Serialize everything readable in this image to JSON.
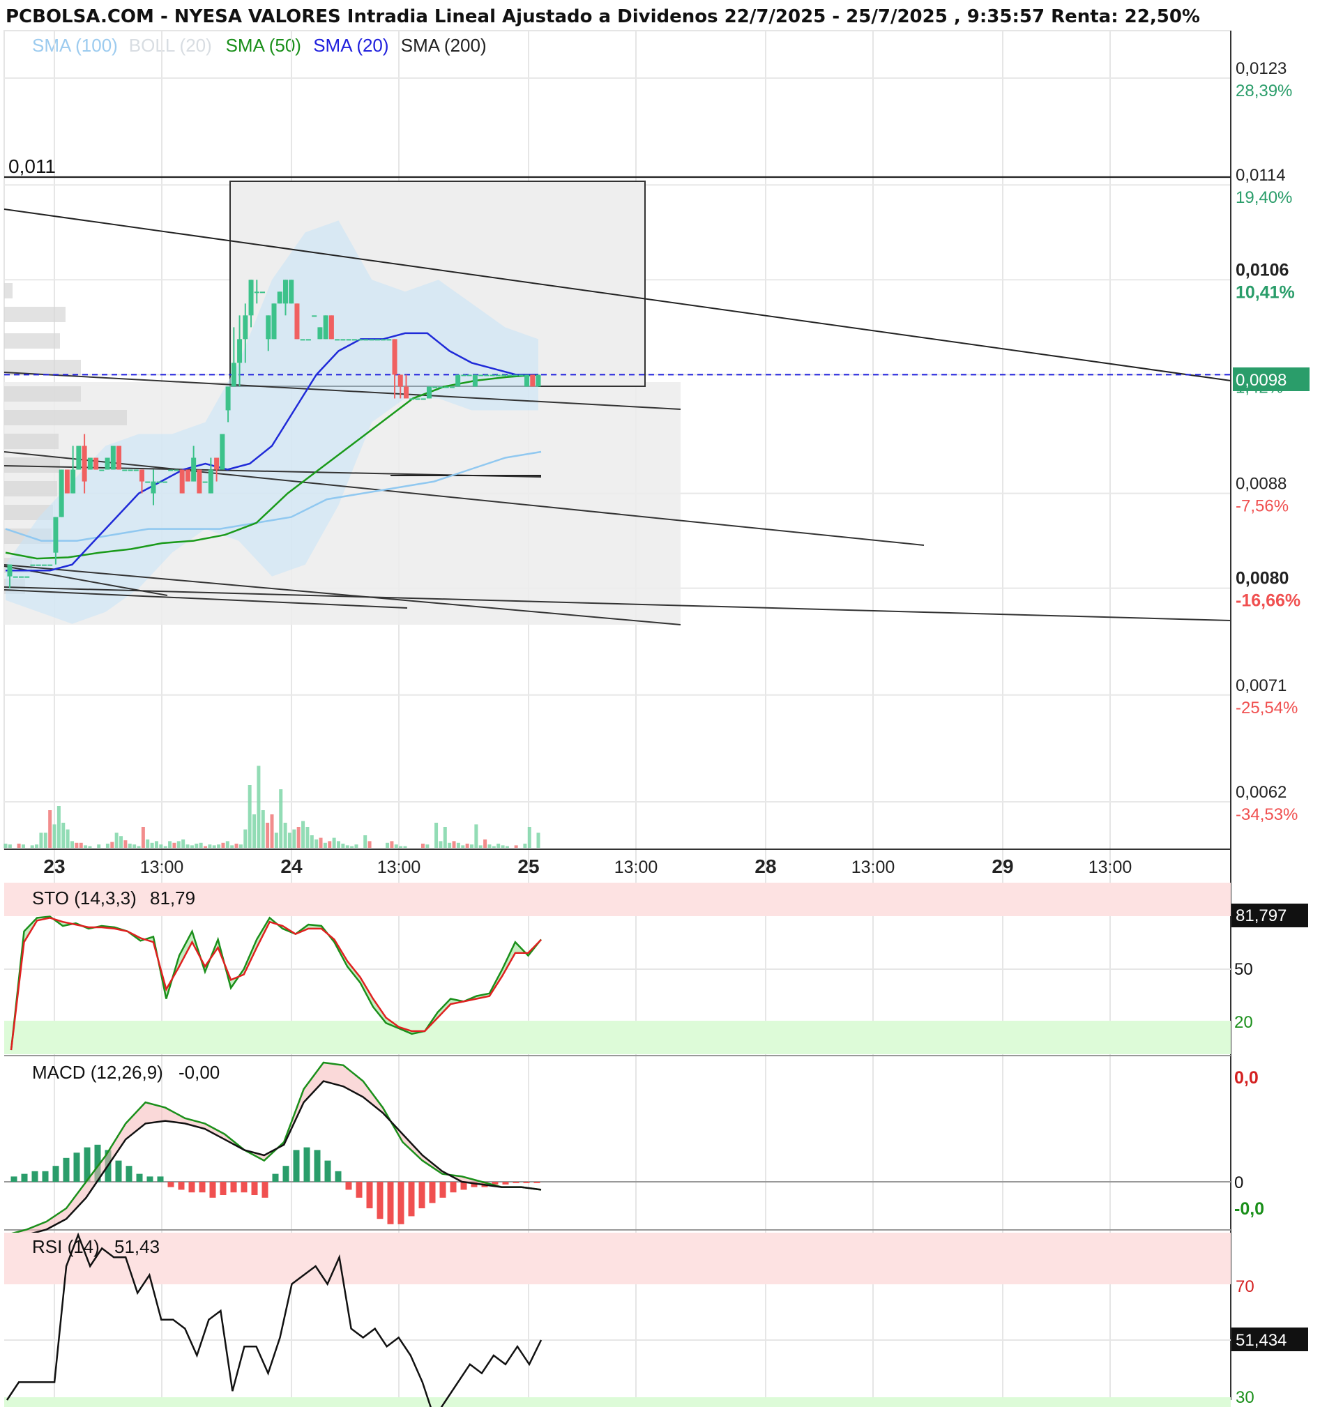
{
  "title": "PCBOLSA.COM - NYESA VALORES Intradia Lineal Ajustado a Dividenos 22/7/2025 - 25/7/2025 , 9:35:57 Renta: 22,50%",
  "colors": {
    "sma100": "#90c8f0",
    "boll": "#cfd6dc",
    "sma50": "#1a9a1a",
    "sma20": "#1f2ad8",
    "sma200": "#222222",
    "up": "#3cc28a",
    "down": "#f06060",
    "current_tag": "#2a9d6a",
    "overbought_fill": "#fde2e2",
    "oversold_fill": "#ddfbd8"
  },
  "legend": [
    {
      "label": "SMA (100)",
      "color": "#9ccbef"
    },
    {
      "label": "BOLL (20)",
      "color": "#d8dde2"
    },
    {
      "label": "SMA (50)",
      "color": "#1a8f1a"
    },
    {
      "label": "SMA (20)",
      "color": "#2020dd"
    },
    {
      "label": "SMA (200)",
      "color": "#222222"
    }
  ],
  "price_label_left": "0,011",
  "current_price_tag": "0,0098",
  "indicators": {
    "sto": {
      "label": "STO (14,3,3)",
      "value": "81,79",
      "tag": "81,797",
      "levels": [
        "50",
        "20"
      ]
    },
    "macd": {
      "label": "MACD (12,26,9)",
      "value": "-0,00",
      "levels": [
        "0,0",
        "0",
        "-0,0"
      ]
    },
    "rsi": {
      "label": "RSI (14)",
      "value": "51,43",
      "tag": "51,434",
      "levels": [
        "70",
        "30"
      ]
    }
  },
  "chart_data": {
    "type": "candlestick",
    "title": "PCBOLSA.COM - NYESA VALORES Intradia Lineal Ajustado a Dividenos 22/7/2025 - 25/7/2025 , 9:35:57 Renta: 22,50%",
    "y_ticks": [
      {
        "price": "0,0123",
        "pct": "28,39%",
        "value": 0.0123,
        "sign": "pos"
      },
      {
        "price": "0,0114",
        "pct": "19,40%",
        "value": 0.0114,
        "sign": "pos"
      },
      {
        "price": "0,0106",
        "pct": "10,41%",
        "value": 0.0106,
        "sign": "pos",
        "bold": true
      },
      {
        "price": "0,0098",
        "pct": "1,42%",
        "value": 0.0098,
        "sign": "pos"
      },
      {
        "price": "0,0088",
        "pct": "-7,56%",
        "value": 0.0088,
        "sign": "neg"
      },
      {
        "price": "0,0080",
        "pct": "-16,66%",
        "value": 0.008,
        "sign": "neg",
        "bold": true
      },
      {
        "price": "0,0071",
        "pct": "-25,54%",
        "value": 0.0071,
        "sign": "neg"
      },
      {
        "price": "0,0062",
        "pct": "-34,53%",
        "value": 0.0062,
        "sign": "neg"
      }
    ],
    "x_ticks": [
      {
        "label": "23",
        "bold": true
      },
      {
        "label": "13:00"
      },
      {
        "label": "24",
        "bold": true
      },
      {
        "label": "13:00"
      },
      {
        "label": "25",
        "bold": true
      },
      {
        "label": "13:00"
      },
      {
        "label": "28",
        "bold": true
      },
      {
        "label": "13:00"
      },
      {
        "label": "29",
        "bold": true
      },
      {
        "label": "13:00"
      }
    ],
    "candles": [
      {
        "o": 0.0081,
        "c": 0.0082,
        "h": 0.0082,
        "l": 0.008
      },
      {
        "o": 0.0081,
        "c": 0.0081,
        "h": 0.0081,
        "l": 0.0081
      },
      {
        "o": 0.0081,
        "c": 0.0081,
        "h": 0.0081,
        "l": 0.0081
      },
      {
        "o": 0.0081,
        "c": 0.0081,
        "h": 0.0081,
        "l": 0.0081
      },
      {
        "o": 0.0082,
        "c": 0.0082,
        "h": 0.0082,
        "l": 0.0082
      },
      {
        "o": 0.0082,
        "c": 0.0082,
        "h": 0.0082,
        "l": 0.0082
      },
      {
        "o": 0.0082,
        "c": 0.0082,
        "h": 0.0082,
        "l": 0.0082
      },
      {
        "o": 0.0082,
        "c": 0.0082,
        "h": 0.0082,
        "l": 0.0082
      },
      {
        "o": 0.0083,
        "c": 0.0086,
        "h": 0.0086,
        "l": 0.0082
      },
      {
        "o": 0.0086,
        "c": 0.009,
        "h": 0.009,
        "l": 0.0086
      },
      {
        "o": 0.009,
        "c": 0.0088,
        "h": 0.009,
        "l": 0.0088
      },
      {
        "o": 0.0088,
        "c": 0.009,
        "h": 0.0092,
        "l": 0.0088
      },
      {
        "o": 0.009,
        "c": 0.0092,
        "h": 0.0092,
        "l": 0.009
      },
      {
        "o": 0.0092,
        "c": 0.0089,
        "h": 0.0093,
        "l": 0.0088
      },
      {
        "o": 0.009,
        "c": 0.0091,
        "h": 0.0091,
        "l": 0.009
      },
      {
        "o": 0.0091,
        "c": 0.009,
        "h": 0.0091,
        "l": 0.009
      },
      {
        "o": 0.009,
        "c": 0.009,
        "h": 0.009,
        "l": 0.009
      },
      {
        "o": 0.009,
        "c": 0.0091,
        "h": 0.0091,
        "l": 0.009
      },
      {
        "o": 0.009,
        "c": 0.0092,
        "h": 0.0092,
        "l": 0.009
      },
      {
        "o": 0.0092,
        "c": 0.009,
        "h": 0.0092,
        "l": 0.009
      },
      {
        "o": 0.009,
        "c": 0.009,
        "h": 0.009,
        "l": 0.009
      },
      {
        "o": 0.009,
        "c": 0.009,
        "h": 0.009,
        "l": 0.009
      },
      {
        "o": 0.009,
        "c": 0.009,
        "h": 0.009,
        "l": 0.009
      },
      {
        "o": 0.009,
        "c": 0.0089,
        "h": 0.009,
        "l": 0.0088
      },
      {
        "o": 0.0089,
        "c": 0.0089,
        "h": 0.0089,
        "l": 0.0089
      },
      {
        "o": 0.0088,
        "c": 0.0089,
        "h": 0.009,
        "l": 0.0087
      },
      {
        "o": 0.0089,
        "c": 0.0089,
        "h": 0.0089,
        "l": 0.0089
      },
      {
        "o": 0.0089,
        "c": 0.0089,
        "h": 0.0089,
        "l": 0.0089
      },
      {
        "o": 0.009,
        "c": 0.009,
        "h": 0.009,
        "l": 0.009
      },
      {
        "o": 0.009,
        "c": 0.009,
        "h": 0.009,
        "l": 0.009
      },
      {
        "o": 0.009,
        "c": 0.0088,
        "h": 0.009,
        "l": 0.0088
      },
      {
        "o": 0.009,
        "c": 0.0089,
        "h": 0.009,
        "l": 0.0089
      },
      {
        "o": 0.0089,
        "c": 0.0091,
        "h": 0.0092,
        "l": 0.0089
      },
      {
        "o": 0.009,
        "c": 0.0088,
        "h": 0.009,
        "l": 0.0088
      },
      {
        "o": 0.0089,
        "c": 0.0089,
        "h": 0.0089,
        "l": 0.0089
      },
      {
        "o": 0.0088,
        "c": 0.009,
        "h": 0.0091,
        "l": 0.0088
      },
      {
        "o": 0.0091,
        "c": 0.009,
        "h": 0.0091,
        "l": 0.0089
      },
      {
        "o": 0.009,
        "c": 0.0093,
        "h": 0.0093,
        "l": 0.009
      },
      {
        "o": 0.0095,
        "c": 0.0097,
        "h": 0.0097,
        "l": 0.0094
      },
      {
        "o": 0.0097,
        "c": 0.0099,
        "h": 0.0102,
        "l": 0.0097
      },
      {
        "o": 0.0099,
        "c": 0.0101,
        "h": 0.0103,
        "l": 0.0097
      },
      {
        "o": 0.0101,
        "c": 0.0103,
        "h": 0.0104,
        "l": 0.0099
      },
      {
        "o": 0.0103,
        "c": 0.0106,
        "h": 0.0106,
        "l": 0.0102
      },
      {
        "o": 0.0105,
        "c": 0.0105,
        "h": 0.0106,
        "l": 0.0104
      },
      {
        "o": 0.0105,
        "c": 0.0105,
        "h": 0.0105,
        "l": 0.0105
      },
      {
        "o": 0.0101,
        "c": 0.0103,
        "h": 0.0103,
        "l": 0.01
      },
      {
        "o": 0.0101,
        "c": 0.0104,
        "h": 0.0104,
        "l": 0.0101
      },
      {
        "o": 0.0104,
        "c": 0.0105,
        "h": 0.0105,
        "l": 0.0104
      },
      {
        "o": 0.0104,
        "c": 0.0106,
        "h": 0.0106,
        "l": 0.0103
      },
      {
        "o": 0.0104,
        "c": 0.0106,
        "h": 0.0106,
        "l": 0.0104
      },
      {
        "o": 0.0104,
        "c": 0.0101,
        "h": 0.0104,
        "l": 0.0101
      },
      {
        "o": 0.0101,
        "c": 0.0101,
        "h": 0.0101,
        "l": 0.0101
      },
      {
        "o": 0.0101,
        "c": 0.0101,
        "h": 0.0101,
        "l": 0.0101
      },
      {
        "o": 0.0103,
        "c": 0.0103,
        "h": 0.0103,
        "l": 0.0103
      },
      {
        "o": 0.0101,
        "c": 0.0102,
        "h": 0.0102,
        "l": 0.0101
      },
      {
        "o": 0.0101,
        "c": 0.0103,
        "h": 0.0103,
        "l": 0.0101
      },
      {
        "o": 0.0103,
        "c": 0.0101,
        "h": 0.0103,
        "l": 0.0101
      },
      {
        "o": 0.0101,
        "c": 0.0101,
        "h": 0.0101,
        "l": 0.0101
      },
      {
        "o": 0.0101,
        "c": 0.0101,
        "h": 0.0101,
        "l": 0.0101
      },
      {
        "o": 0.0101,
        "c": 0.0101,
        "h": 0.0101,
        "l": 0.0101
      },
      {
        "o": 0.0101,
        "c": 0.0101,
        "h": 0.0101,
        "l": 0.0101
      },
      {
        "o": 0.0101,
        "c": 0.0101,
        "h": 0.0101,
        "l": 0.0101
      },
      {
        "o": 0.0101,
        "c": 0.0101,
        "h": 0.0101,
        "l": 0.0101
      },
      {
        "o": 0.0101,
        "c": 0.0101,
        "h": 0.0101,
        "l": 0.0101
      },
      {
        "o": 0.0101,
        "c": 0.0101,
        "h": 0.0101,
        "l": 0.0101
      },
      {
        "o": 0.0101,
        "c": 0.0101,
        "h": 0.0101,
        "l": 0.0101
      },
      {
        "o": 0.0101,
        "c": 0.0101,
        "h": 0.0101,
        "l": 0.0101
      },
      {
        "o": 0.0101,
        "c": 0.0098,
        "h": 0.0101,
        "l": 0.0096
      },
      {
        "o": 0.0098,
        "c": 0.0097,
        "h": 0.0098,
        "l": 0.0096
      },
      {
        "o": 0.0097,
        "c": 0.0096,
        "h": 0.0098,
        "l": 0.0096
      },
      {
        "o": 0.0096,
        "c": 0.0096,
        "h": 0.0096,
        "l": 0.0096
      },
      {
        "o": 0.0096,
        "c": 0.0096,
        "h": 0.0096,
        "l": 0.0096
      },
      {
        "o": 0.0096,
        "c": 0.0096,
        "h": 0.0096,
        "l": 0.0096
      },
      {
        "o": 0.0096,
        "c": 0.0097,
        "h": 0.0097,
        "l": 0.0096
      },
      {
        "o": 0.0097,
        "c": 0.0097,
        "h": 0.0097,
        "l": 0.0097
      },
      {
        "o": 0.0097,
        "c": 0.0097,
        "h": 0.0097,
        "l": 0.0097
      },
      {
        "o": 0.0097,
        "c": 0.0097,
        "h": 0.0097,
        "l": 0.0097
      },
      {
        "o": 0.0097,
        "c": 0.0097,
        "h": 0.0097,
        "l": 0.0097
      },
      {
        "o": 0.0097,
        "c": 0.0098,
        "h": 0.0098,
        "l": 0.0097
      },
      {
        "o": 0.0098,
        "c": 0.0098,
        "h": 0.0098,
        "l": 0.0098
      },
      {
        "o": 0.0098,
        "c": 0.0098,
        "h": 0.0098,
        "l": 0.0098
      },
      {
        "o": 0.0097,
        "c": 0.0098,
        "h": 0.0098,
        "l": 0.0097
      },
      {
        "o": 0.0098,
        "c": 0.0098,
        "h": 0.0098,
        "l": 0.0098
      },
      {
        "o": 0.0098,
        "c": 0.0098,
        "h": 0.0098,
        "l": 0.0098
      },
      {
        "o": 0.0098,
        "c": 0.0098,
        "h": 0.0098,
        "l": 0.0098
      },
      {
        "o": 0.0098,
        "c": 0.0098,
        "h": 0.0098,
        "l": 0.0098
      },
      {
        "o": 0.0098,
        "c": 0.0098,
        "h": 0.0098,
        "l": 0.0098
      },
      {
        "o": 0.0098,
        "c": 0.0098,
        "h": 0.0098,
        "l": 0.0098
      },
      {
        "o": 0.0098,
        "c": 0.0098,
        "h": 0.0098,
        "l": 0.0098
      },
      {
        "o": 0.0098,
        "c": 0.0098,
        "h": 0.0098,
        "l": 0.0098
      },
      {
        "o": 0.0097,
        "c": 0.0098,
        "h": 0.0098,
        "l": 0.0097
      },
      {
        "o": 0.0098,
        "c": 0.0097,
        "h": 0.0098,
        "l": 0.0097
      },
      {
        "o": 0.0097,
        "c": 0.0098,
        "h": 0.0098,
        "l": 0.0097
      }
    ],
    "volume_scale_max": 100,
    "volumes": [
      5,
      4,
      0,
      5,
      4,
      0,
      3,
      4,
      18,
      18,
      45,
      28,
      50,
      30,
      22,
      8,
      6,
      6,
      3,
      2,
      0,
      4,
      0,
      5,
      7,
      18,
      14,
      9,
      5,
      4,
      2,
      25,
      10,
      6,
      8,
      4,
      2,
      8,
      6,
      8,
      10,
      4,
      3,
      5,
      6,
      2,
      4,
      3,
      4,
      6,
      8,
      3,
      5,
      4,
      22,
      75,
      40,
      98,
      45,
      30,
      40,
      18,
      70,
      30,
      18,
      22,
      25,
      32,
      25,
      15,
      10,
      12,
      6,
      8,
      12,
      8,
      5,
      3,
      2,
      4,
      0,
      15,
      8,
      0,
      0,
      0,
      6,
      8,
      4,
      2,
      2,
      0,
      0,
      0,
      5,
      4,
      0,
      30,
      8,
      25,
      6,
      8,
      6,
      3,
      5,
      4,
      28,
      3,
      10,
      4,
      2,
      5,
      3,
      2,
      0,
      3,
      0,
      5,
      25,
      0,
      18
    ],
    "sma20": [
      0.00815,
      0.00815,
      0.00815,
      0.0082,
      0.0084,
      0.0086,
      0.0088,
      0.0089,
      0.009,
      0.00905,
      0.009,
      0.00905,
      0.0092,
      0.0095,
      0.0098,
      0.01,
      0.0101,
      0.0101,
      0.01015,
      0.01015,
      0.01,
      0.0099,
      0.00985,
      0.0098,
      0.0098
    ],
    "sma50": [
      0.0083,
      0.00825,
      0.00826,
      0.0083,
      0.00833,
      0.00838,
      0.0084,
      0.00845,
      0.00855,
      0.0088,
      0.009,
      0.0092,
      0.0094,
      0.0096,
      0.0097,
      0.00975,
      0.00978,
      0.0098
    ],
    "sma100": [
      0.0085,
      0.0084,
      0.0084,
      0.00845,
      0.0085,
      0.0085,
      0.0085,
      0.00855,
      0.0086,
      0.00875,
      0.0088,
      0.00885,
      0.0089,
      0.009,
      0.0091,
      0.00915
    ],
    "sma200": [
      0.0092,
      0.00915,
      0.0091,
      0.0091,
      0.0091
    ],
    "boll_upper": [
      0.0082,
      0.0086,
      0.0089,
      0.0092,
      0.0093,
      0.0093,
      0.0094,
      0.0099,
      0.0106,
      0.011,
      0.0111,
      0.0106,
      0.0105,
      0.0106,
      0.0104,
      0.0102,
      0.0101
    ],
    "boll_lower": [
      0.0079,
      0.0078,
      0.0077,
      0.0078,
      0.008,
      0.0083,
      0.0085,
      0.0084,
      0.0081,
      0.0082,
      0.0087,
      0.0094,
      0.0096,
      0.0096,
      0.0095,
      0.0095,
      0.0095
    ],
    "levels": [
      {
        "name": "0,011",
        "value": 0.011
      }
    ],
    "current_price": 0.0098,
    "stochastic": {
      "k": [
        0,
        88,
        98,
        99,
        92,
        94,
        90,
        92,
        91,
        88,
        81,
        84,
        38,
        70,
        88,
        58,
        82,
        46,
        60,
        82,
        98,
        90,
        86,
        93,
        92,
        80,
        62,
        50,
        32,
        20,
        16,
        12,
        14,
        28,
        38,
        36,
        40,
        42,
        60,
        80,
        70,
        82
      ],
      "d": [
        0,
        80,
        96,
        98,
        95,
        93,
        91,
        91,
        90,
        88,
        83,
        80,
        45,
        62,
        80,
        62,
        76,
        52,
        56,
        76,
        95,
        92,
        86,
        90,
        90,
        82,
        66,
        54,
        38,
        24,
        17,
        14,
        14,
        24,
        34,
        36,
        38,
        40,
        55,
        72,
        72,
        81.79
      ]
    },
    "macd": {
      "line": [
        -2,
        -1.8,
        -1.5,
        -1,
        0,
        1,
        2.2,
        3,
        2.8,
        2.4,
        2.2,
        1.8,
        1.2,
        0.8,
        1.5,
        3.5,
        4.5,
        4.4,
        3.8,
        2.8,
        1.5,
        0.8,
        0.3,
        0.2,
        0,
        -0.2,
        -0.2,
        -0.3
      ],
      "signal": [
        -2.2,
        -2,
        -1.8,
        -1.4,
        -0.6,
        0.5,
        1.6,
        2.2,
        2.3,
        2.2,
        2,
        1.6,
        1.2,
        1,
        1.4,
        3,
        3.8,
        3.6,
        3.2,
        2.6,
        1.8,
        1,
        0.4,
        0,
        -0.1,
        -0.2,
        -0.2,
        -0.3
      ],
      "histogram": [
        0.2,
        0.3,
        0.4,
        0.4,
        0.6,
        0.9,
        1.1,
        1.3,
        1.4,
        1.2,
        0.8,
        0.6,
        0.3,
        0.2,
        0.2,
        -0.2,
        -0.3,
        -0.4,
        -0.4,
        -0.6,
        -0.5,
        -0.4,
        -0.4,
        -0.5,
        -0.6,
        0.3,
        0.6,
        1.2,
        1.3,
        1.2,
        0.8,
        0.4,
        -0.3,
        -0.6,
        -1.0,
        -1.4,
        -1.6,
        -1.6,
        -1.3,
        -1.0,
        -0.8,
        -0.6,
        -0.4,
        -0.3,
        -0.2,
        -0.2,
        -0.1,
        -0.1,
        -0.05,
        -0.05,
        -0.05
      ]
    },
    "rsi": [
      38,
      42,
      42,
      42,
      42,
      68,
      75,
      68,
      72,
      70,
      70,
      62,
      66,
      56,
      56,
      54,
      48,
      56,
      58,
      40,
      50,
      50,
      44,
      52,
      64,
      66,
      68,
      64,
      70,
      54,
      52,
      54,
      50,
      52,
      48,
      42,
      34,
      38,
      42,
      46,
      44,
      48,
      46,
      50,
      46,
      51.43
    ]
  }
}
